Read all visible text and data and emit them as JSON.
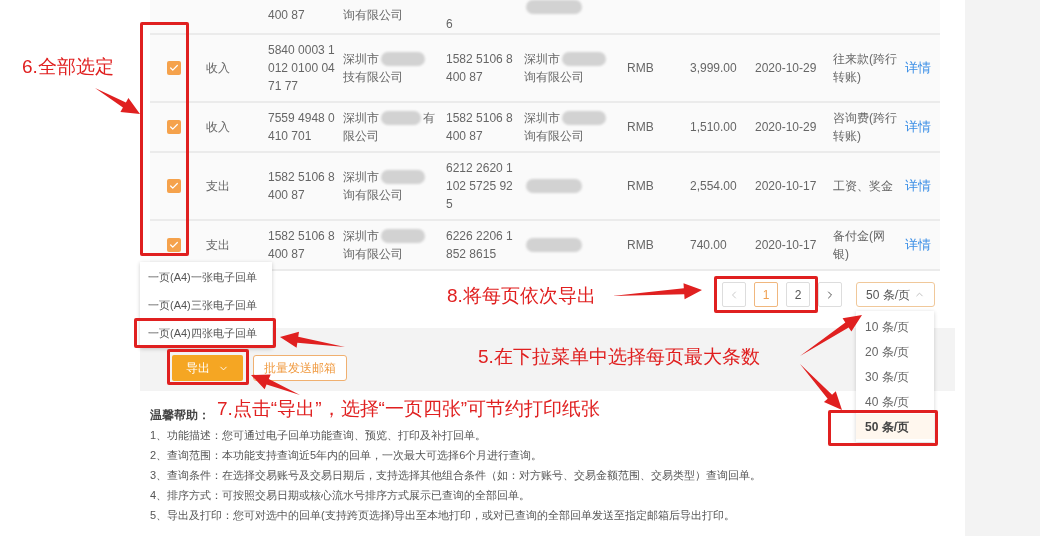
{
  "table": {
    "rows": [
      {
        "kind": "partial",
        "account": "400 87",
        "name": {
          "lines": [
            [
              "询有限公司"
            ]
          ]
        },
        "counter_account": "6",
        "counter_name": {
          "redacted": true
        }
      },
      {
        "kind": "full",
        "checked": true,
        "type": "收入",
        "account": "5840 0003 1\n012 0100 04\n71 77",
        "name": {
          "redacted": true,
          "lines": [
            [
              "深圳市"
            ],
            [
              "技有限公司"
            ]
          ]
        },
        "counter_account": "1582 5106 8\n400 87",
        "counter_name": {
          "redacted": true,
          "lines": [
            [
              "深圳市"
            ],
            [
              "询有限公司"
            ]
          ]
        },
        "currency": "RMB",
        "amount": "3,999.00",
        "date": "2020-10-29",
        "purpose": "往来款(跨行转账)",
        "detail": "详情"
      },
      {
        "kind": "full",
        "checked": true,
        "type": "收入",
        "account": "7559 4948 0\n410 701",
        "name": {
          "redacted": true,
          "lines": [
            [
              "深圳市",
              "有"
            ],
            [
              "限公司"
            ]
          ]
        },
        "counter_account": "1582 5106 8\n400 87",
        "counter_name": {
          "redacted": true,
          "lines": [
            [
              "深圳市"
            ],
            [
              "询有限公司"
            ]
          ]
        },
        "currency": "RMB",
        "amount": "1,510.00",
        "date": "2020-10-29",
        "purpose": "咨询费(跨行转账)",
        "detail": "详情"
      },
      {
        "kind": "full",
        "checked": true,
        "type": "支出",
        "account": "1582 5106 8\n400 87",
        "name": {
          "redacted": true,
          "lines": [
            [
              "深圳市"
            ],
            [
              "询有限公司"
            ]
          ]
        },
        "counter_account": "6212 2620 1\n102 5725 92\n5",
        "counter_name": {
          "redacted": true
        },
        "currency": "RMB",
        "amount": "2,554.00",
        "date": "2020-10-17",
        "purpose": "工资、奖金",
        "detail": "详情"
      },
      {
        "kind": "full",
        "checked": true,
        "type": "支出",
        "account": "1582 5106 8\n400 87",
        "name": {
          "redacted": true,
          "lines": [
            [
              "深圳市"
            ],
            [
              "询有限公司"
            ]
          ]
        },
        "counter_account": "6226 2206 1\n852 8615",
        "counter_name": {
          "redacted": true
        },
        "currency": "RMB",
        "amount": "740.00",
        "date": "2020-10-17",
        "purpose": "备付金(网银)",
        "detail": "详情"
      }
    ]
  },
  "pagination": {
    "prev_disabled": true,
    "next_disabled": false,
    "pages": [
      {
        "label": "1",
        "selected": true
      },
      {
        "label": "2",
        "selected": false
      }
    ],
    "page_size": {
      "value": "50 条/页",
      "open": true,
      "options": [
        {
          "label": "10 条/页",
          "selected": false
        },
        {
          "label": "20 条/页",
          "selected": false
        },
        {
          "label": "30 条/页",
          "selected": false
        },
        {
          "label": "40 条/页",
          "selected": false
        },
        {
          "label": "50 条/页",
          "selected": true
        }
      ]
    }
  },
  "export_menu": {
    "open": true,
    "items": [
      "一页(A4)一张电子回单",
      "一页(A4)三张电子回单",
      "一页(A4)四张电子回单"
    ]
  },
  "actions": [
    {
      "kind": "primary",
      "label": "导出"
    },
    {
      "kind": "outline",
      "label": "批量发送邮箱"
    }
  ],
  "help": {
    "title": "温馨帮助：",
    "items": [
      "1、功能描述：您可通过电子回单功能查询、预览、打印及补打回单。",
      "2、查询范围：本功能支持查询近5年内的回单，一次最大可选择6个月进行查询。",
      "3、查询条件：在选择交易账号及交易日期后，支持选择其他组合条件（如：对方账号、交易金额范围、交易类型）查询回单。",
      "4、排序方式：可按照交易日期或核心流水号排序方式展示已查询的全部回单。",
      "5、导出及打印：您可对选中的回单(支持跨页选择)导出至本地打印，或对已查询的全部回单发送至指定邮箱后导出打印。"
    ]
  },
  "annotations": [
    "6.全部选定",
    "8.将每页依次导出",
    "5.在下拉菜单中选择每页最大条数",
    "7.点击“导出”，选择“一页四张”可节约打印纸张"
  ]
}
